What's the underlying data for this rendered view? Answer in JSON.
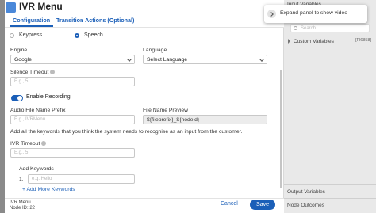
{
  "modal": {
    "title": "IVR Menu",
    "tabs": [
      {
        "label": "Configuration",
        "active": true
      },
      {
        "label": "Transition Actions (Optional)",
        "active": false
      }
    ],
    "input_type": {
      "options": [
        "Keypress",
        "Speech"
      ],
      "selected": "Speech"
    },
    "engine": {
      "label": "Engine",
      "value": "Google"
    },
    "language": {
      "label": "Language",
      "placeholder": "Select Language"
    },
    "silence_timeout": {
      "label": "Silence Timeout",
      "placeholder": "E.g., 5"
    },
    "enable_recording": {
      "label": "Enable Recording",
      "on": true
    },
    "audio_file_name_prefix": {
      "label": "Audio File Name Prefix",
      "placeholder": "E.g., IVRMenu"
    },
    "file_name_preview": {
      "label": "File Name Preview",
      "value": "${fileprefix}_${nodeid}"
    },
    "description": "Add all the keywords that you think the system needs to recognise as an input from the customer.",
    "ivr_timeout": {
      "label": "IVR Timeout",
      "placeholder": "E.g., 5"
    },
    "keywords": {
      "label": "Add Keywords",
      "items": [
        {
          "number": "1.",
          "placeholder": "e.g. Hello"
        }
      ],
      "add_more_label": "+ Add More Keywords"
    },
    "footer": {
      "node_name": "IVR Menu",
      "node_id": "Node ID: 22",
      "cancel_label": "Cancel",
      "save_label": "Save"
    }
  },
  "right_panel": {
    "input_variables_label": "Input Variables",
    "search_placeholder": "Search",
    "custom_variables_label": "Custom Variables",
    "custom_variables_badge": "[Fl6858]",
    "output_variables_label": "Output Variables",
    "node_outcomes_label": "Node Outcomes"
  },
  "tooltip": {
    "text": "Expand panel to show video"
  },
  "colors": {
    "accent": "#1b5fb8",
    "panel_bg": "#e9e9e9"
  }
}
